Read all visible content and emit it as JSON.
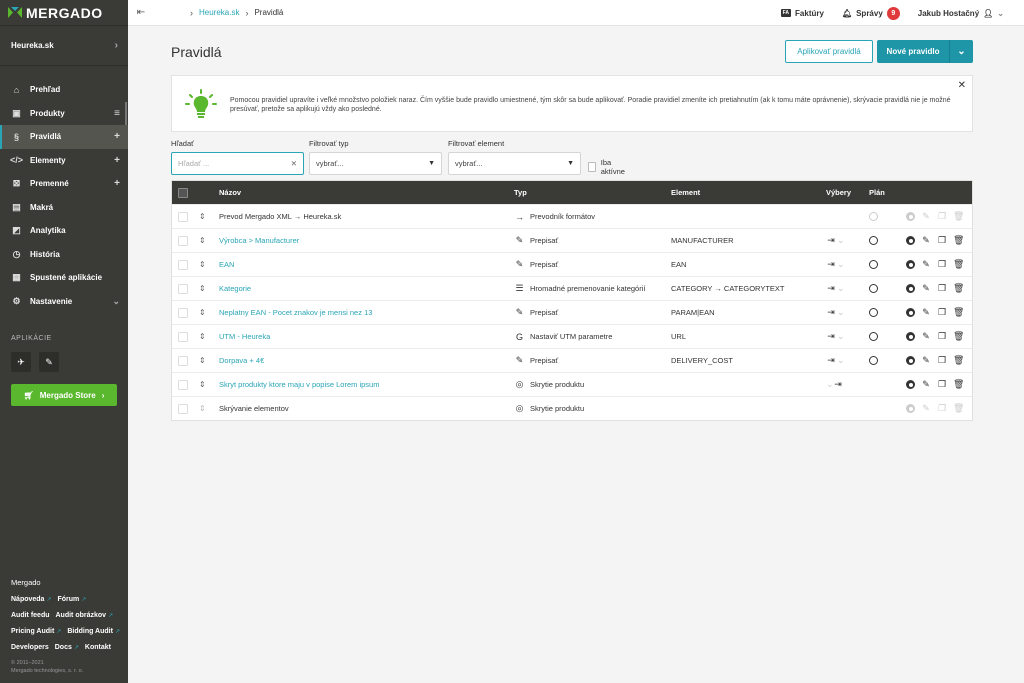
{
  "app": {
    "logo": "MERGADO",
    "shop": "Heureka.sk"
  },
  "sidebar": {
    "items": [
      {
        "label": "Prehľad",
        "icon": "home-icon",
        "suffix": ""
      },
      {
        "label": "Produkty",
        "icon": "box-icon",
        "suffix": "list"
      },
      {
        "label": "Pravidlá",
        "icon": "paragraph-icon",
        "suffix": "+",
        "active": true
      },
      {
        "label": "Elementy",
        "icon": "code-icon",
        "suffix": "+"
      },
      {
        "label": "Premenné",
        "icon": "variable-icon",
        "suffix": "+"
      },
      {
        "label": "Makrá",
        "icon": "macro-icon",
        "suffix": ""
      },
      {
        "label": "Analytika",
        "icon": "chart-icon",
        "suffix": ""
      },
      {
        "label": "História",
        "icon": "history-icon",
        "suffix": ""
      },
      {
        "label": "Spustené aplikácie",
        "icon": "apps-icon",
        "suffix": ""
      },
      {
        "label": "Nastavenie",
        "icon": "gear-icon",
        "suffix": "chevron"
      }
    ],
    "apps_title": "APLIKÁCIE",
    "store_label": "Mergado Store",
    "footer": {
      "heading": "Mergado",
      "rows": [
        [
          "Nápoveda",
          "Fórum"
        ],
        [
          "Audit feedu",
          "Audit obrázkov"
        ],
        [
          "Pricing Audit",
          "Bidding Audit"
        ],
        [
          "Developers",
          "Docs",
          "Kontakt"
        ]
      ],
      "copyright_1": "© 2011–2021",
      "copyright_2": "Mergado technologies, s. r. o."
    }
  },
  "topbar": {
    "breadcrumb_link": "Heureka.sk",
    "breadcrumb_current": "Pravidlá",
    "invoices": "Faktúry",
    "messages": "Správy",
    "messages_count": "9",
    "user": "Jakub Hostačný"
  },
  "page": {
    "title": "Pravidlá",
    "apply_button": "Aplikovať pravidlá",
    "new_button": "Nové pravidlo",
    "info_text": "Pomocou pravidiel upravíte i veľké množstvo položiek naraz. Čím vyššie bude pravidlo umiestnené, tým skôr sa bude aplikovať. Poradie pravidiel zmeníte ich pretiahnutím (ak k tomu máte oprávnenie), skrývacie pravidlá nie je možné presúvať, pretože sa aplikujú vždy ako posledné."
  },
  "filters": {
    "search_label": "Hľadať",
    "search_placeholder": "Hľadať ...",
    "type_label": "Filtrovať typ",
    "type_value": "vybrať...",
    "element_label": "Filtrovať element",
    "element_value": "vybrať...",
    "active_only": "Iba aktívne"
  },
  "table": {
    "headers": {
      "name": "Názov",
      "type": "Typ",
      "element": "Element",
      "vybery": "Výbery",
      "plan": "Plán"
    },
    "rows": [
      {
        "name": "Prevod Mergado XML → Heureka.sk",
        "type": "Prevodník formátov",
        "type_icon": "arrow-right-icon",
        "element": "",
        "linked": false,
        "enabled": true,
        "sel": false
      },
      {
        "name": "Výrobca > Manufacturer",
        "type": "Prepisať",
        "type_icon": "pencil-icon",
        "element": "MANUFACTURER",
        "linked": true,
        "enabled": true,
        "sel": true
      },
      {
        "name": "EAN",
        "type": "Prepisať",
        "type_icon": "pencil-icon",
        "element": "EAN",
        "linked": true,
        "enabled": true,
        "sel": true
      },
      {
        "name": "Kategorie",
        "type": "Hromadné premenovanie kategórií",
        "type_icon": "list-icon",
        "element": "CATEGORY → CATEGORYTEXT",
        "linked": true,
        "enabled": true,
        "sel": true
      },
      {
        "name": "Neplatny EAN - Pocet znakov je mensi nez 13",
        "type": "Prepisať",
        "type_icon": "pencil-icon",
        "element": "PARAM|EAN",
        "linked": true,
        "enabled": true,
        "sel": true
      },
      {
        "name": "UTM - Heureka",
        "type": "Nastaviť UTM parametre",
        "type_icon": "google-icon",
        "element": "URL",
        "linked": true,
        "enabled": true,
        "sel": true
      },
      {
        "name": "Dorpava + 4€",
        "type": "Prepisať",
        "type_icon": "pencil-icon",
        "element": "DELIVERY_COST",
        "linked": true,
        "enabled": true,
        "sel": true
      },
      {
        "name": "Skryt produkty ktore maju v popise Lorem ipsum",
        "type": "Skrytie produktu",
        "type_icon": "eye-slash-icon",
        "element": "",
        "linked": true,
        "enabled": true,
        "sel": "hide"
      },
      {
        "name": "Skrývanie elementov",
        "type": "Skrytie produktu",
        "type_icon": "eye-slash-icon",
        "element": "",
        "linked": false,
        "enabled": false,
        "sel": false
      }
    ]
  }
}
